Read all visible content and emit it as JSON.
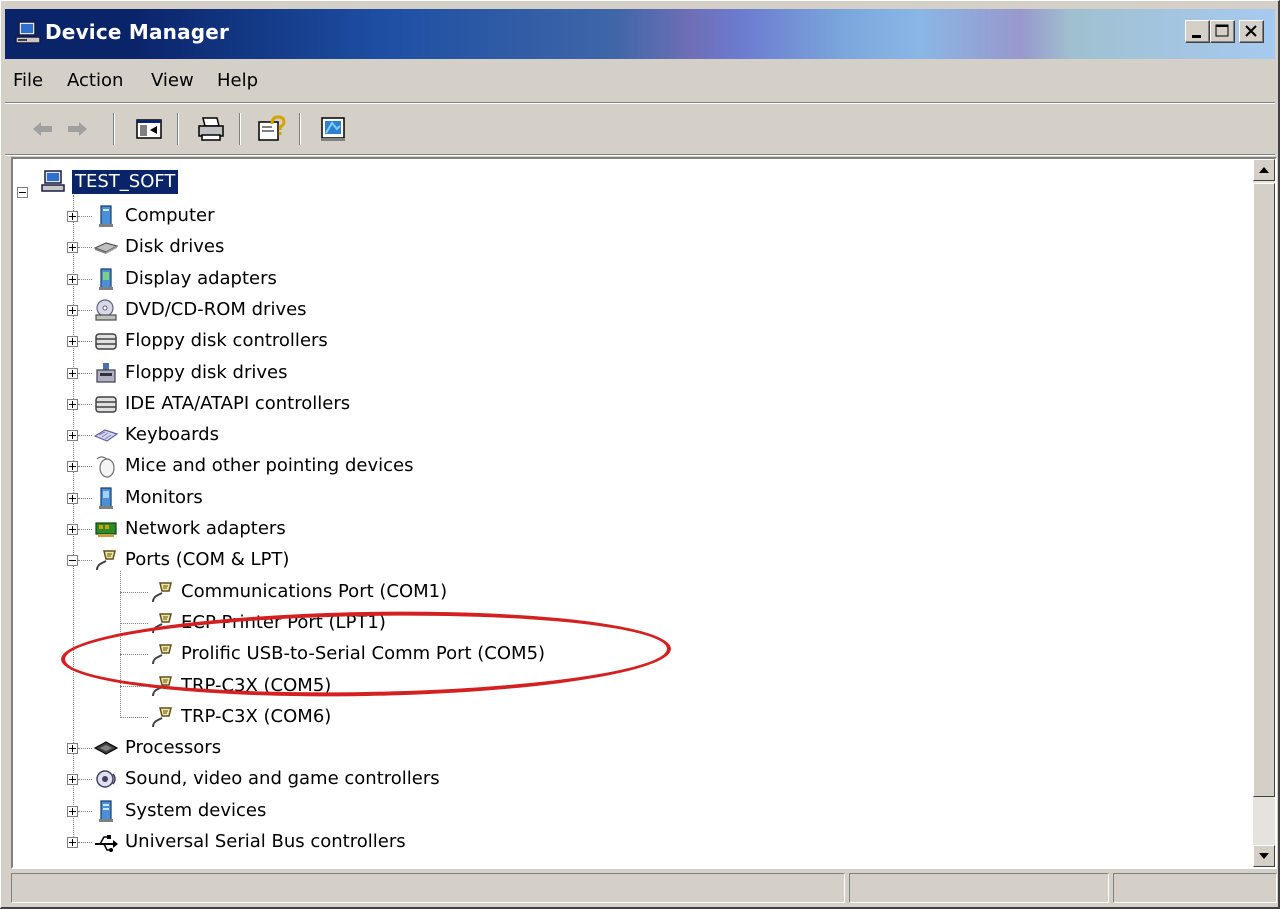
{
  "window": {
    "title": "Device Manager",
    "colors": {
      "title_start": "#0a246a",
      "selection": "#0a246a",
      "highlight_ring": "#d42020",
      "face": "#d4d0c8"
    }
  },
  "menu": [
    "File",
    "Action",
    "View",
    "Help"
  ],
  "toolbar": {
    "buttons": [
      "back-arrow-icon",
      "forward-arrow-icon",
      "show-hide-console-tree-icon",
      "print-icon",
      "help-icon",
      "scan-hardware-icon"
    ]
  },
  "tree": {
    "root": "TEST_SOFT",
    "categories_top": [
      {
        "label": "Computer",
        "icon": "computer-icon"
      },
      {
        "label": "Disk drives",
        "icon": "disk-drive-icon"
      },
      {
        "label": "Display adapters",
        "icon": "display-adapter-icon"
      },
      {
        "label": "DVD/CD-ROM drives",
        "icon": "dvd-drive-icon"
      },
      {
        "label": "Floppy disk controllers",
        "icon": "controller-icon"
      },
      {
        "label": "Floppy disk drives",
        "icon": "floppy-drive-icon"
      },
      {
        "label": "IDE ATA/ATAPI controllers",
        "icon": "controller-icon"
      },
      {
        "label": "Keyboards",
        "icon": "keyboard-icon"
      },
      {
        "label": "Mice and other pointing devices",
        "icon": "mouse-icon"
      },
      {
        "label": "Monitors",
        "icon": "monitor-icon"
      },
      {
        "label": "Network adapters",
        "icon": "network-adapter-icon"
      }
    ],
    "ports": {
      "label": "Ports (COM & LPT)",
      "icon": "port-icon",
      "children": [
        "Communications Port (COM1)",
        "ECP Printer Port (LPT1)",
        "Prolific USB-to-Serial Comm Port (COM5)",
        "TRP-C3X (COM5)",
        "TRP-C3X (COM6)"
      ]
    },
    "categories_bottom": [
      {
        "label": "Processors",
        "icon": "processor-icon"
      },
      {
        "label": "Sound, video and game controllers",
        "icon": "sound-icon"
      },
      {
        "label": "System devices",
        "icon": "system-device-icon"
      },
      {
        "label": "Universal Serial Bus controllers",
        "icon": "usb-icon"
      }
    ]
  },
  "status": [
    "",
    "",
    ""
  ]
}
